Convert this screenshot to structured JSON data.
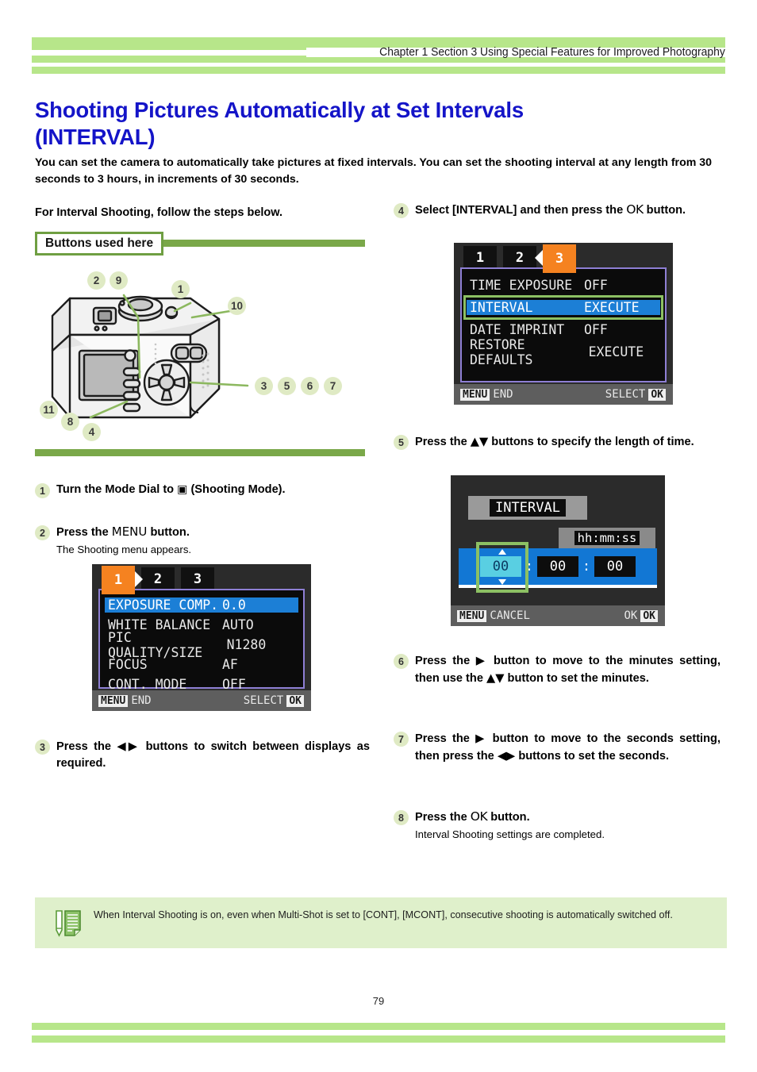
{
  "header": {
    "chapter": "Chapter 1 Section 3 Using Special Features for Improved Photography"
  },
  "title": {
    "line1": "Shooting Pictures Automatically at Set Intervals",
    "line2": "(INTERVAL)"
  },
  "intro": "You can set the camera to automatically take pictures at fixed intervals. You can set the shooting interval at any length from 30 seconds to 3 hours, in increments of 30 seconds.",
  "leadin": "For Interval Shooting, follow the steps below.",
  "buttons_box": {
    "label": "Buttons used here"
  },
  "camera_callouts": [
    "2",
    "9",
    "1",
    "10",
    "3",
    "5",
    "6",
    "7",
    "11",
    "8",
    "4"
  ],
  "steps": [
    {
      "num": "1",
      "head_a": "Turn the Mode Dial to ",
      "icon": "camera-mode-icon",
      "head_b": " (Shooting Mode).",
      "sub": ""
    },
    {
      "num": "2",
      "head_a": "Press the ",
      "icon": "MENU",
      "head_b": " button.",
      "sub": "The Shooting menu appears."
    },
    {
      "num": "3",
      "head_a": "Press the ",
      "icon": "left-right-arrows",
      "head_b": " buttons to switch between displays as required.",
      "sub": ""
    },
    {
      "num": "4",
      "head_a": "Select  [INTERVAL] and then press the ",
      "icon": "OK",
      "head_b": " button.",
      "sub": ""
    },
    {
      "num": "5",
      "head_a": "Press the ",
      "icon": "up-down-arrows",
      "head_b": " buttons to specify the length of time.",
      "sub": ""
    },
    {
      "num": "6",
      "head_a": "Press the ",
      "icon": "right-arrow",
      "head_b": " button to move to the minutes setting, then use the ",
      "icon2": "up-down-arrows",
      "head_c": " button to set the minutes.",
      "sub": ""
    },
    {
      "num": "7",
      "head_a": "Press the ",
      "icon": "right-arrow",
      "head_b": " button to move to the seconds setting, then press the ",
      "icon2": "left-right-arrows",
      "head_c": " buttons to set the seconds.",
      "sub": ""
    },
    {
      "num": "8",
      "head_a": "Press the ",
      "icon": "OK",
      "head_b": " button.",
      "sub": "Interval Shooting settings are completed."
    }
  ],
  "lcd_shooting_menu": {
    "tabs": [
      {
        "label": "1",
        "active": true
      },
      {
        "label": "2",
        "active": false
      },
      {
        "label": "3",
        "active": false
      }
    ],
    "rows": [
      {
        "name": "EXPOSURE COMP.",
        "value": "0.0",
        "selected": true
      },
      {
        "name": "WHITE BALANCE",
        "value": "AUTO",
        "selected": false
      },
      {
        "name": "PIC QUALITY/SIZE",
        "value": "N1280",
        "selected": false
      },
      {
        "name": "FOCUS",
        "value": "AF",
        "selected": false
      },
      {
        "name": "CONT. MODE",
        "value": "OFF",
        "selected": false
      }
    ],
    "status": {
      "left_key": "MENU",
      "left_label": "END",
      "right_label": "SELECT",
      "right_key": "OK"
    }
  },
  "lcd_setup_menu": {
    "tabs": [
      {
        "label": "1",
        "active": false
      },
      {
        "label": "2",
        "active": false
      },
      {
        "label": "3",
        "active": true
      }
    ],
    "rows": [
      {
        "name": "TIME EXPOSURE",
        "value": "OFF",
        "selected": false
      },
      {
        "name": "INTERVAL",
        "value": "EXECUTE",
        "selected": true
      },
      {
        "name": "DATE IMPRINT",
        "value": "OFF",
        "selected": false
      },
      {
        "name": "RESTORE DEFAULTS",
        "value": "EXECUTE",
        "selected": false
      }
    ],
    "status": {
      "left_key": "MENU",
      "left_label": "END",
      "right_label": "SELECT",
      "right_key": "OK"
    }
  },
  "lcd_interval": {
    "title": "INTERVAL",
    "format_label": "hh:mm:ss",
    "hours": "00",
    "minutes": "00",
    "seconds": "00",
    "separator": ":",
    "status": {
      "left_key": "MENU",
      "left_label": "CANCEL",
      "right_label": "OK",
      "right_key": "OK"
    }
  },
  "note": {
    "text": "When Interval Shooting is on, even when Multi-Shot is set to [CONT], [MCONT], consecutive shooting is automatically switched off."
  },
  "footer": {
    "page": "79"
  },
  "colors": {
    "green_light": "#b7e68a",
    "green_pale": "#dff0cb",
    "green_dark": "#7aa849",
    "title_blue": "#1414c8",
    "accent_orange": "#f58220",
    "select_blue": "#1c7fd6",
    "badge": "#dfeac4"
  }
}
